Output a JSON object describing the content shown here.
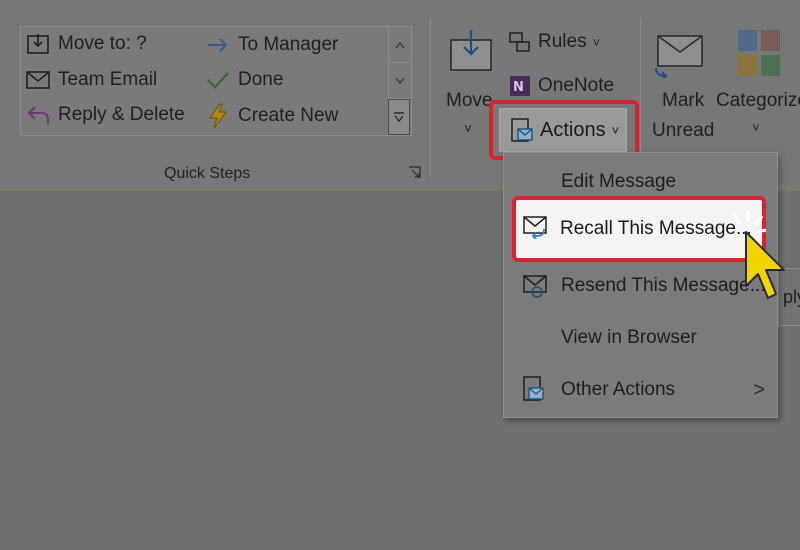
{
  "quick_steps": {
    "items": [
      {
        "label": "Move to: ?",
        "icon": "move-to-folder-icon"
      },
      {
        "label": "To Manager",
        "icon": "arrow-right-icon"
      },
      {
        "label": "Team Email",
        "icon": "envelope-icon"
      },
      {
        "label": "Done",
        "icon": "checkmark-icon"
      },
      {
        "label": "Reply & Delete",
        "icon": "reply-icon"
      },
      {
        "label": "Create New",
        "icon": "lightning-icon"
      }
    ],
    "group_label": "Quick Steps"
  },
  "move": {
    "label": "Move",
    "chevron": "˅"
  },
  "rules": {
    "label": "Rules",
    "chevron": "˅"
  },
  "onenote": {
    "label": "OneNote"
  },
  "actions": {
    "label": "Actions",
    "chevron": "˅"
  },
  "mark_unread": {
    "line1": "Mark",
    "line2": "Unread"
  },
  "categorize": {
    "label": "Categorize",
    "chevron": "˅"
  },
  "menu": {
    "items": [
      {
        "label": "Edit Message"
      },
      {
        "label": "Recall This Message..."
      },
      {
        "label": "Resend This Message..."
      },
      {
        "label": "View in Browser"
      },
      {
        "label": "Other Actions",
        "arrow": ">"
      }
    ]
  },
  "partial_right": "ply",
  "colors": {
    "highlight": "#d8222f",
    "cursor": "#f2d500",
    "accent_blue": "#2f7fc9"
  }
}
